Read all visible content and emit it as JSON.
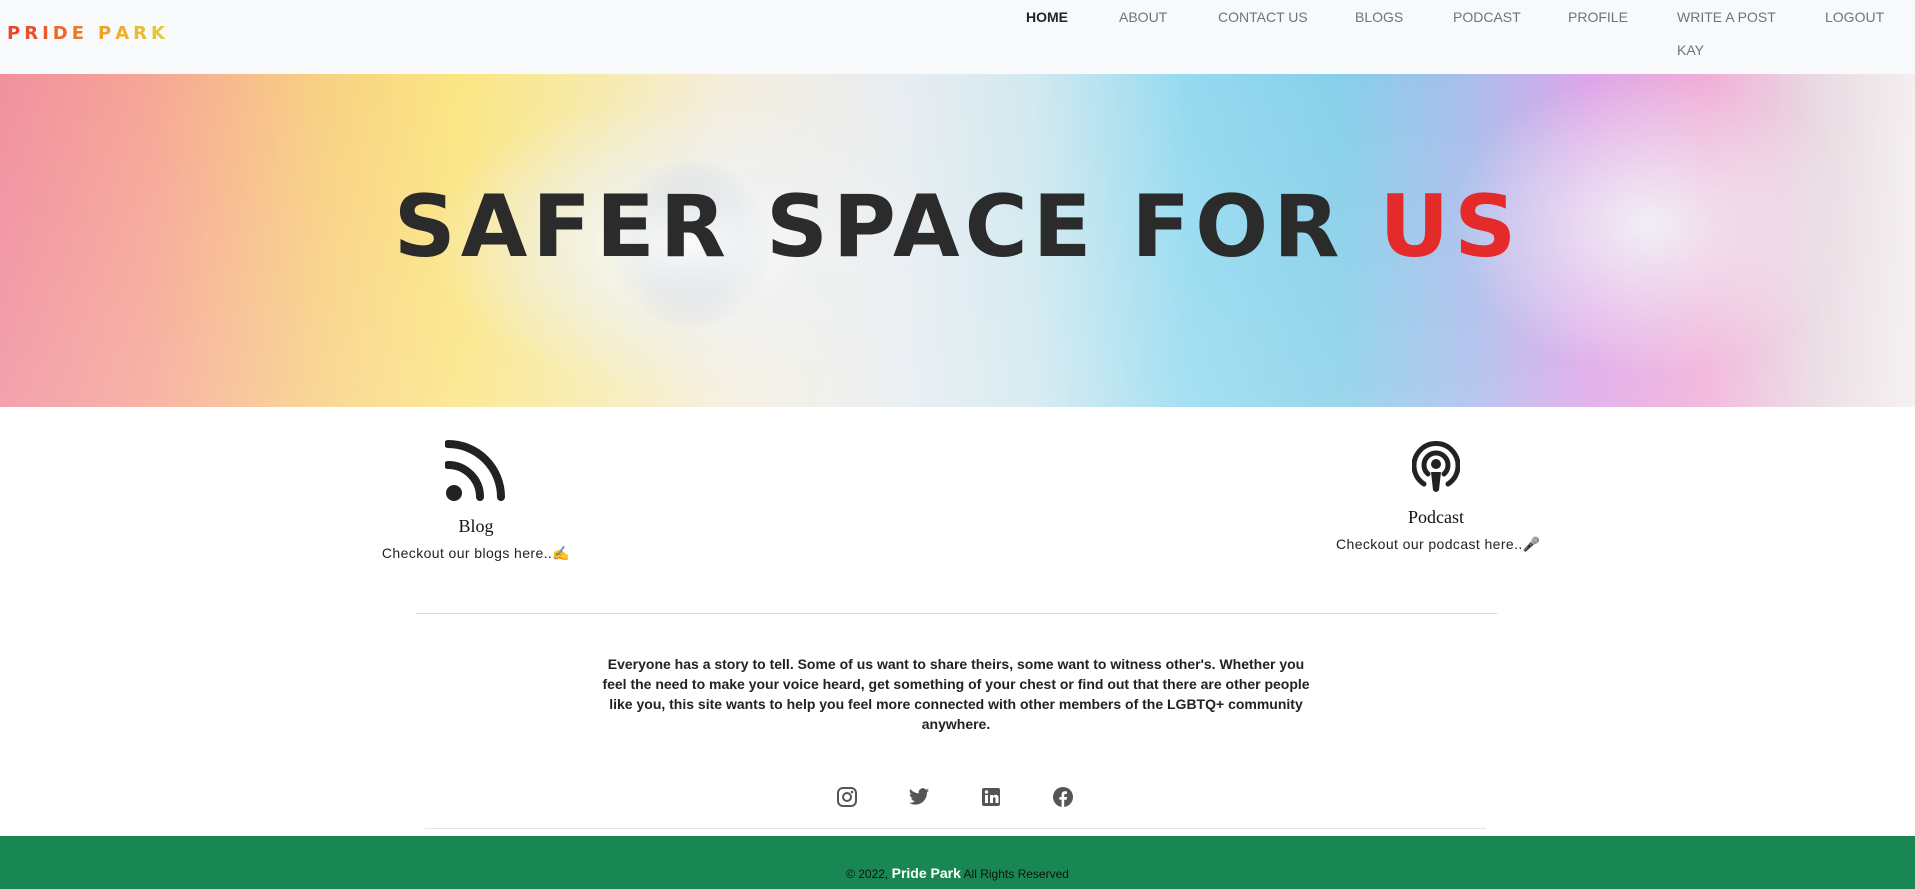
{
  "brand": {
    "letters": [
      {
        "char": "P",
        "color": "#e8472d"
      },
      {
        "char": "R",
        "color": "#e8502c"
      },
      {
        "char": "I",
        "color": "#ea5a2a"
      },
      {
        "char": "D",
        "color": "#ec6a27"
      },
      {
        "char": "E",
        "color": "#ef7a24"
      },
      {
        "char": "P",
        "color": "#efa028"
      },
      {
        "char": "A",
        "color": "#eeae2a"
      },
      {
        "char": "R",
        "color": "#e7bd30"
      },
      {
        "char": "K",
        "color": "#dfc935"
      }
    ]
  },
  "nav": {
    "items": [
      {
        "label": "HOME",
        "active": true
      },
      {
        "label": "ABOUT",
        "active": false
      },
      {
        "label": "CONTACT US",
        "active": false
      },
      {
        "label": "BLOGS",
        "active": false
      },
      {
        "label": "PODCAST",
        "active": false
      },
      {
        "label": "PROFILE",
        "active": false
      },
      {
        "label": "WRITE A POST",
        "active": false
      },
      {
        "label": "LOGOUT",
        "active": false
      },
      {
        "label": "KAY",
        "active": false
      }
    ]
  },
  "hero": {
    "title_main": "SAFER SPACE FOR ",
    "title_accent": "US",
    "accent_color": "#e52a2a"
  },
  "features": {
    "blog": {
      "icon": "rss-icon",
      "title": "Blog",
      "text": "Checkout our blogs here..",
      "emoji": "✍️"
    },
    "podcast": {
      "icon": "podcast-icon",
      "title": "Podcast",
      "text": "Checkout our podcast here..",
      "emoji": "🎤"
    }
  },
  "about": {
    "text": "Everyone has a story to tell. Some of us want to share theirs, some want to witness other's. Whether you feel the need to make your voice heard, get something of your chest or find out that there are other people like you, this site wants to help you feel more connected with other members of the LGBTQ+ community anywhere."
  },
  "social": {
    "icons": [
      "instagram-icon",
      "twitter-icon",
      "linkedin-icon",
      "facebook-icon"
    ]
  },
  "footer": {
    "prefix": "© 2022, ",
    "brand": "Pride Park",
    "suffix": " All Rights Reserved",
    "bg_color": "#198754"
  }
}
